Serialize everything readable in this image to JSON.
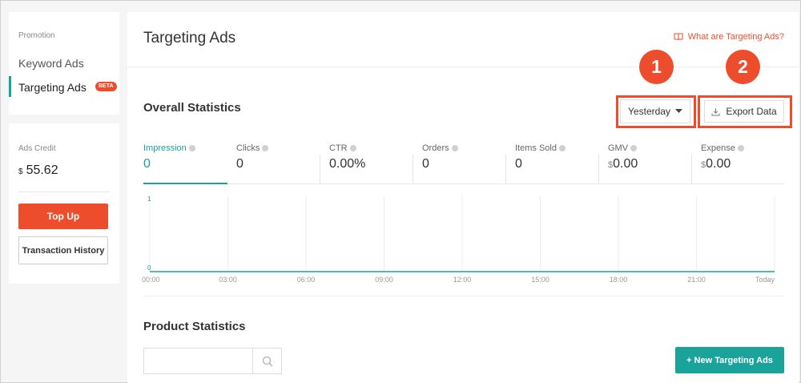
{
  "colors": {
    "accent": "#ee4d2d",
    "teal": "#1aa39a"
  },
  "sidebar": {
    "section_label": "Promotion",
    "items": [
      {
        "label": "Keyword Ads",
        "active": false
      },
      {
        "label": "Targeting Ads",
        "active": true,
        "badge": "BETA"
      }
    ],
    "credit": {
      "label": "Ads Credit",
      "currency": "$",
      "amount": "55.62",
      "top_up_label": "Top Up",
      "history_label": "Transaction History"
    }
  },
  "header": {
    "title": "Targeting Ads",
    "help_link": "What are Targeting Ads?",
    "help_icon": "book-icon"
  },
  "annotations": {
    "one": "1",
    "two": "2"
  },
  "overall": {
    "title": "Overall Statistics",
    "date_filter": "Yesterday",
    "export_label": "Export Data",
    "metrics": [
      {
        "label": "Impression",
        "value": "0",
        "prefix": "",
        "active": true
      },
      {
        "label": "Clicks",
        "value": "0",
        "prefix": ""
      },
      {
        "label": "CTR",
        "value": "0.00%",
        "prefix": ""
      },
      {
        "label": "Orders",
        "value": "0",
        "prefix": ""
      },
      {
        "label": "Items Sold",
        "value": "0",
        "prefix": ""
      },
      {
        "label": "GMV",
        "value": "0.00",
        "prefix": "$"
      },
      {
        "label": "Expense",
        "value": "0.00",
        "prefix": "$"
      }
    ]
  },
  "chart_data": {
    "type": "line",
    "x": [
      "00:00",
      "03:00",
      "06:00",
      "09:00",
      "12:00",
      "15:00",
      "18:00",
      "21:00",
      "Today"
    ],
    "values": [
      0,
      0,
      0,
      0,
      0,
      0,
      0,
      0,
      0
    ],
    "y_ticks": [
      "1",
      "0"
    ],
    "ylim": [
      0,
      1
    ],
    "grid": true,
    "series": [
      {
        "values": [
          0,
          0,
          0,
          0,
          0,
          0,
          0,
          0,
          0
        ],
        "color": "#1aa39a"
      }
    ]
  },
  "product": {
    "title": "Product Statistics",
    "search_placeholder": "",
    "new_button": "+ New Targeting Ads"
  }
}
